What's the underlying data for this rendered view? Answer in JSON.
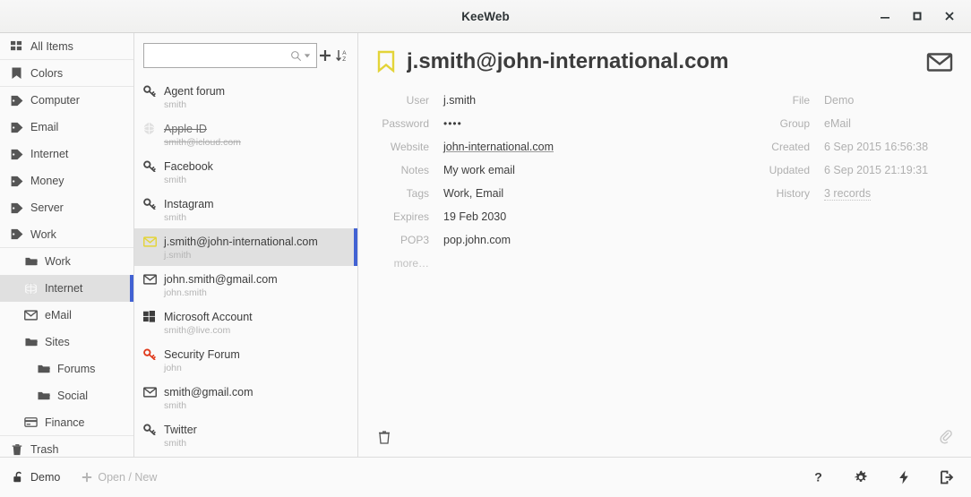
{
  "window": {
    "title": "KeeWeb",
    "minimize_label": "Minimize",
    "maximize_label": "Maximize",
    "close_label": "Close"
  },
  "sidebar": {
    "items": [
      {
        "label": "All Items",
        "icon": "grid-icon",
        "level": 0,
        "selected": false,
        "sep_below": true
      },
      {
        "label": "Colors",
        "icon": "bookmark-icon",
        "level": 0,
        "selected": false,
        "sep_below": true
      },
      {
        "label": "Computer",
        "icon": "tag-icon",
        "level": 0,
        "selected": false,
        "sep_below": false
      },
      {
        "label": "Email",
        "icon": "tag-icon",
        "level": 0,
        "selected": false,
        "sep_below": false
      },
      {
        "label": "Internet",
        "icon": "tag-icon",
        "level": 0,
        "selected": false,
        "sep_below": false
      },
      {
        "label": "Money",
        "icon": "tag-icon",
        "level": 0,
        "selected": false,
        "sep_below": false
      },
      {
        "label": "Server",
        "icon": "tag-icon",
        "level": 0,
        "selected": false,
        "sep_below": false
      },
      {
        "label": "Work",
        "icon": "tag-icon",
        "level": 0,
        "selected": false,
        "sep_below": true
      },
      {
        "label": "Work",
        "icon": "folder-icon",
        "level": 1,
        "selected": false,
        "sep_below": false
      },
      {
        "label": "Internet",
        "icon": "globe-icon",
        "level": 1,
        "selected": true,
        "sep_below": false
      },
      {
        "label": "eMail",
        "icon": "envelope-icon",
        "level": 1,
        "selected": false,
        "sep_below": false
      },
      {
        "label": "Sites",
        "icon": "folder-icon",
        "level": 1,
        "selected": false,
        "sep_below": false
      },
      {
        "label": "Forums",
        "icon": "folder-icon",
        "level": 2,
        "selected": false,
        "sep_below": false
      },
      {
        "label": "Social",
        "icon": "folder-icon",
        "level": 2,
        "selected": false,
        "sep_below": false
      },
      {
        "label": "Finance",
        "icon": "card-icon",
        "level": 1,
        "selected": false,
        "sep_below": true
      },
      {
        "label": "Trash",
        "icon": "trash-icon",
        "level": 0,
        "selected": false,
        "sep_below": false
      }
    ]
  },
  "search": {
    "value": "",
    "placeholder": "",
    "search_icon": "search-icon",
    "dropdown_icon": "caret-down-icon",
    "add_icon": "plus-icon",
    "sort_icon": "sort-az-icon"
  },
  "entries": [
    {
      "title": "Agent forum",
      "desc": "smith",
      "icon": "key-icon",
      "icon_color": "#4a4a4a",
      "selected": false,
      "expired": false
    },
    {
      "title": "Apple ID",
      "desc": "smith@icloud.com",
      "icon": "globe-icon",
      "icon_color": "#4a4a4a",
      "selected": false,
      "expired": true
    },
    {
      "title": "Facebook",
      "desc": "smith",
      "icon": "key-icon",
      "icon_color": "#4a4a4a",
      "selected": false,
      "expired": false
    },
    {
      "title": "Instagram",
      "desc": "smith",
      "icon": "key-icon",
      "icon_color": "#4a4a4a",
      "selected": false,
      "expired": false
    },
    {
      "title": "j.smith@john-international.com",
      "desc": "j.smith",
      "icon": "envelope-icon",
      "icon_color": "#e3d438",
      "selected": true,
      "expired": false
    },
    {
      "title": "john.smith@gmail.com",
      "desc": "john.smith",
      "icon": "envelope-icon",
      "icon_color": "#4a4a4a",
      "selected": false,
      "expired": false
    },
    {
      "title": "Microsoft Account",
      "desc": "smith@live.com",
      "icon": "windows-icon",
      "icon_color": "#3d3d3d",
      "selected": false,
      "expired": false
    },
    {
      "title": "Security Forum",
      "desc": "john",
      "icon": "key-icon",
      "icon_color": "#e03a1c",
      "selected": false,
      "expired": false
    },
    {
      "title": "smith@gmail.com",
      "desc": "smith",
      "icon": "envelope-icon",
      "icon_color": "#4a4a4a",
      "selected": false,
      "expired": false
    },
    {
      "title": "Twitter",
      "desc": "smith",
      "icon": "key-icon",
      "icon_color": "#4a4a4a",
      "selected": false,
      "expired": false
    }
  ],
  "details": {
    "title": "j.smith@john-international.com",
    "bookmark_icon": "bookmark-outline-icon",
    "mail_icon": "envelope-icon",
    "left_fields": [
      {
        "label": "User",
        "value": "j.smith",
        "style": "plain"
      },
      {
        "label": "Password",
        "value": "••••",
        "style": "password"
      },
      {
        "label": "Website",
        "value": "john-international.com",
        "style": "link"
      },
      {
        "label": "Notes",
        "value": "My work email",
        "style": "plain"
      },
      {
        "label": "Tags",
        "value": "Work, Email",
        "style": "plain"
      },
      {
        "label": "Expires",
        "value": "19 Feb 2030",
        "style": "plain"
      },
      {
        "label": "POP3",
        "value": "pop.john.com",
        "style": "plain"
      },
      {
        "label": "more…",
        "value": "",
        "style": "more"
      }
    ],
    "right_fields": [
      {
        "label": "File",
        "value": "Demo",
        "style": "muted"
      },
      {
        "label": "Group",
        "value": "eMail",
        "style": "muted"
      },
      {
        "label": "Created",
        "value": "6 Sep 2015 16:56:38",
        "style": "muted"
      },
      {
        "label": "Updated",
        "value": "6 Sep 2015 21:19:31",
        "style": "muted"
      },
      {
        "label": "History",
        "value": "3 records",
        "style": "dotlink"
      }
    ],
    "delete_icon": "trash-icon",
    "attachment_icon": "paperclip-icon"
  },
  "footer": {
    "file_label": "Demo",
    "file_icon": "unlock-icon",
    "open_new_label": "Open / New",
    "open_new_icon": "plus-icon",
    "buttons": [
      {
        "name": "help",
        "icon": "question-icon"
      },
      {
        "name": "settings",
        "icon": "gear-icon"
      },
      {
        "name": "generate",
        "icon": "bolt-icon"
      },
      {
        "name": "lock",
        "icon": "logout-icon"
      }
    ]
  },
  "colors": {
    "accent": "#4262d3",
    "selection_bg": "#e0e0e0",
    "bookmark_yellow": "#e3d438",
    "alert_red": "#e03a1c",
    "background": "#fafafa"
  }
}
